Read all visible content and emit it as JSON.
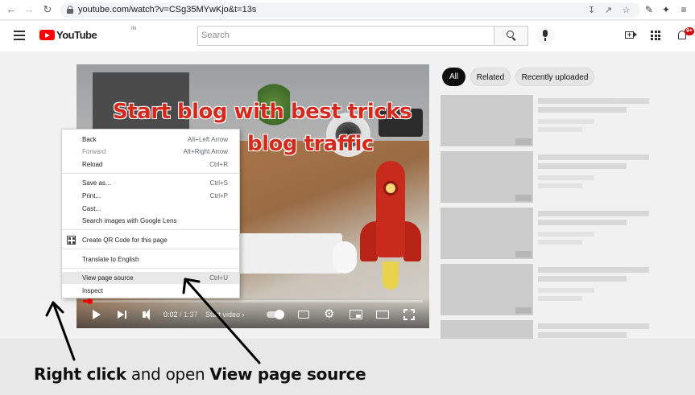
{
  "browser": {
    "url": "youtube.com/watch?v=CSg35MYwKjo&t=13s",
    "back_icon": "arrow-left-icon",
    "forward_icon": "arrow-right-icon",
    "reload_icon": "reload-icon"
  },
  "header": {
    "logo_text": "YouTube",
    "region": "IN",
    "search_placeholder": "Search",
    "notification_count": "9+"
  },
  "video": {
    "overlay_line1": "Start blog with best tricks",
    "overlay_line2": "blog traffic",
    "time_current": "0:02",
    "time_total": "1:37",
    "time_separator": " / ",
    "chapter_label": "Start video ›",
    "progress_fraction": 0.02
  },
  "context_menu": {
    "items": [
      {
        "label": "Back",
        "shortcut": "Alt+Left Arrow"
      },
      {
        "label": "Forward",
        "shortcut": "Alt+Right Arrow"
      },
      {
        "label": "Reload",
        "shortcut": "Ctrl+R"
      },
      {
        "label": "Save as...",
        "shortcut": "Ctrl+S"
      },
      {
        "label": "Print...",
        "shortcut": "Ctrl+P"
      },
      {
        "label": "Cast...",
        "shortcut": ""
      },
      {
        "label": "Search images with Google Lens",
        "shortcut": ""
      },
      {
        "label": "Create QR Code for this page",
        "shortcut": ""
      },
      {
        "label": "Translate to English",
        "shortcut": ""
      },
      {
        "label": "View page source",
        "shortcut": "Ctrl+U"
      },
      {
        "label": "Inspect",
        "shortcut": ""
      }
    ]
  },
  "chips": [
    "All",
    "Related",
    "Recently uploaded"
  ],
  "caption": {
    "part1": "Right click",
    "part2": " and open ",
    "part3": "View page source"
  },
  "colors": {
    "youtube_red": "#ff0000",
    "caption_band": "#e8e8e8",
    "menu_highlight": "#e8e8e8"
  }
}
